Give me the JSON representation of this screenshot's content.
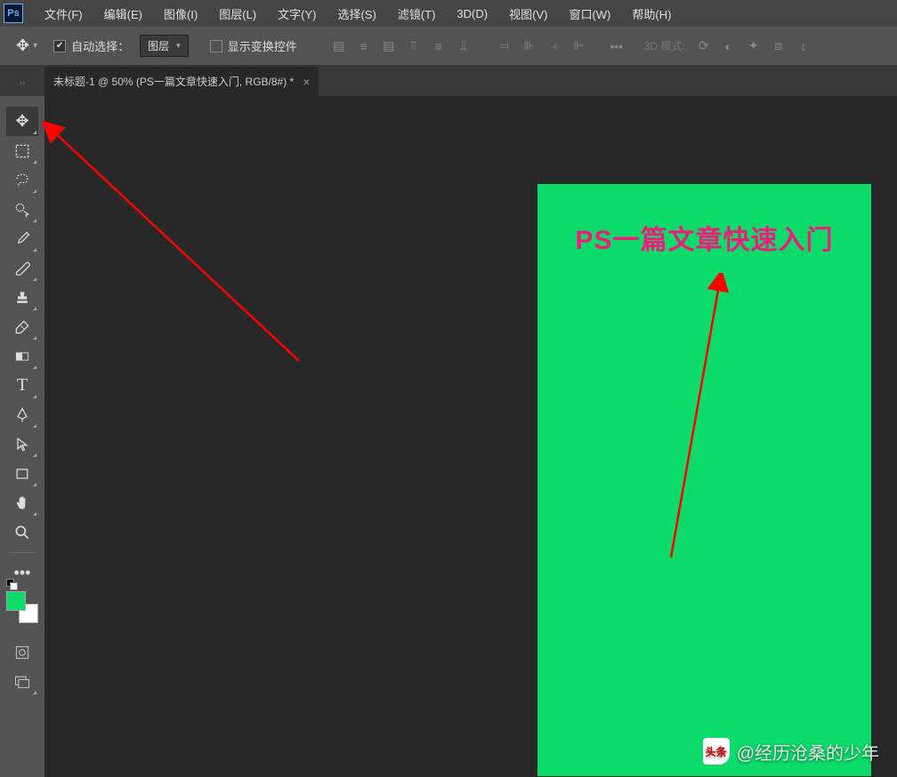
{
  "menubar": {
    "items": [
      {
        "label": "文件(F)"
      },
      {
        "label": "编辑(E)"
      },
      {
        "label": "图像(I)"
      },
      {
        "label": "图层(L)"
      },
      {
        "label": "文字(Y)"
      },
      {
        "label": "选择(S)"
      },
      {
        "label": "滤镜(T)"
      },
      {
        "label": "3D(D)"
      },
      {
        "label": "视图(V)"
      },
      {
        "label": "窗口(W)"
      },
      {
        "label": "帮助(H)"
      }
    ]
  },
  "optionsbar": {
    "auto_select_checked": true,
    "auto_select_label": "自动选择：",
    "layer_select_value": "图层",
    "show_transform_checked": false,
    "show_transform_label": "显示变换控件",
    "mode_3d_label": "3D 模式:"
  },
  "tab": {
    "title": "未标题-1 @ 50% (PS一篇文章快速入门, RGB/8#) *"
  },
  "canvas": {
    "text": "PS一篇文章快速入门",
    "bg_color": "#0bdb6b",
    "text_color": "#ed1e79"
  },
  "tools": [
    {
      "name": "move-tool",
      "selected": true,
      "sub": true
    },
    {
      "name": "marquee-tool",
      "sub": true
    },
    {
      "name": "lasso-tool",
      "sub": true
    },
    {
      "name": "quick-select-tool",
      "sub": true
    },
    {
      "name": "eyedropper-tool",
      "sub": true
    },
    {
      "name": "brush-tool",
      "sub": true
    },
    {
      "name": "stamp-tool",
      "sub": true
    },
    {
      "name": "eraser-tool",
      "sub": true
    },
    {
      "name": "gradient-tool",
      "sub": true
    },
    {
      "name": "type-tool",
      "sub": true
    },
    {
      "name": "pen-tool",
      "sub": true
    },
    {
      "name": "path-select-tool",
      "sub": true
    },
    {
      "name": "rectangle-tool",
      "sub": true
    },
    {
      "name": "hand-tool",
      "sub": true
    },
    {
      "name": "zoom-tool",
      "sub": false
    }
  ],
  "swatches": {
    "fg": "#0bdb6b",
    "bg": "#ffffff"
  },
  "watermark": {
    "brand": "头条",
    "handle": "@经历沧桑的少年"
  }
}
